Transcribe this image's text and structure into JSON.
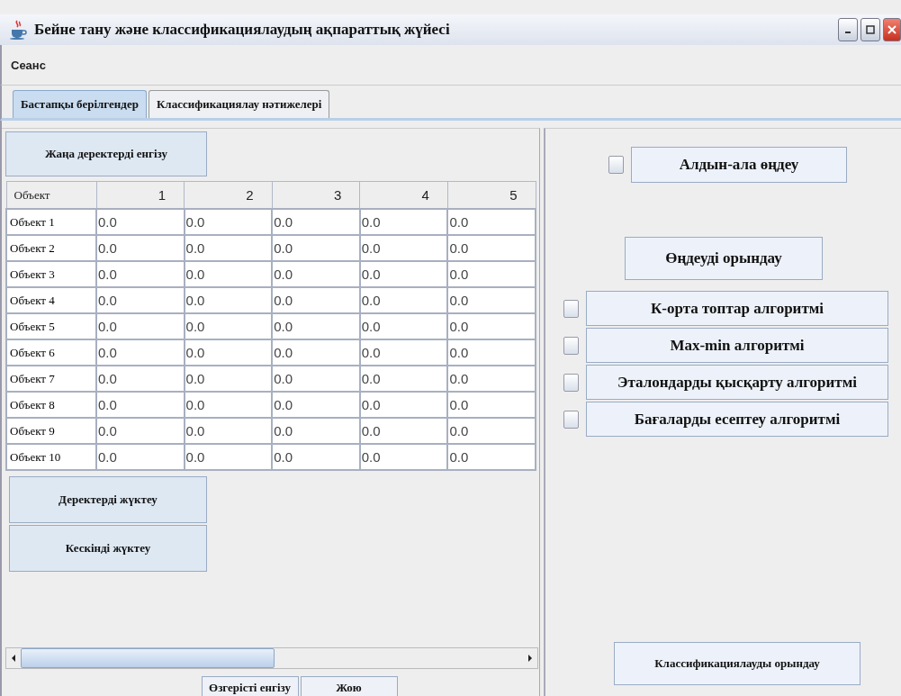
{
  "window": {
    "title": "Бейне тану және классификациялаудың ақпараттық жүйесі"
  },
  "menu": [
    "Сеанс"
  ],
  "tabs": [
    {
      "label": "Бастапқы берілгендер",
      "selected": true
    },
    {
      "label": "Классификациялау нәтижелері",
      "selected": false
    }
  ],
  "new_data_button": "Жаңа деректерді енгізу",
  "table": {
    "columns": [
      "Объект",
      "1",
      "2",
      "3",
      "4",
      "5"
    ],
    "rows": [
      [
        "Объект 1",
        "0.0",
        "0.0",
        "0.0",
        "0.0",
        "0.0"
      ],
      [
        "Объект 2",
        "0.0",
        "0.0",
        "0.0",
        "0.0",
        "0.0"
      ],
      [
        "Объект 3",
        "0.0",
        "0.0",
        "0.0",
        "0.0",
        "0.0"
      ],
      [
        "Объект 4",
        "0.0",
        "0.0",
        "0.0",
        "0.0",
        "0.0"
      ],
      [
        "Объект 5",
        "0.0",
        "0.0",
        "0.0",
        "0.0",
        "0.0"
      ],
      [
        "Объект 6",
        "0.0",
        "0.0",
        "0.0",
        "0.0",
        "0.0"
      ],
      [
        "Объект 7",
        "0.0",
        "0.0",
        "0.0",
        "0.0",
        "0.0"
      ],
      [
        "Объект 8",
        "0.0",
        "0.0",
        "0.0",
        "0.0",
        "0.0"
      ],
      [
        "Объект 9",
        "0.0",
        "0.0",
        "0.0",
        "0.0",
        "0.0"
      ],
      [
        "Объект 10",
        "0.0",
        "0.0",
        "0.0",
        "0.0",
        "0.0"
      ]
    ]
  },
  "load_buttons": [
    "Деректерді жүктеу",
    "Кескінді жүктеу"
  ],
  "bottom_buttons": [
    "Өзгерісті енгізу",
    "Жою"
  ],
  "preprocess": {
    "label": "Алдын-ала өңдеу",
    "checked": false
  },
  "run_processing_button": "Өңдеуді орындау",
  "algorithms": [
    {
      "label": "К-орта топтар алгоритмі",
      "checked": false
    },
    {
      "label": "Max-min алгоритмі",
      "checked": false
    },
    {
      "label": "Эталондарды қысқарту алгоритмі",
      "checked": false
    },
    {
      "label": "Бағаларды есептеу алгоритмі",
      "checked": false
    }
  ],
  "classify_button": "Классификациялауды орындау"
}
